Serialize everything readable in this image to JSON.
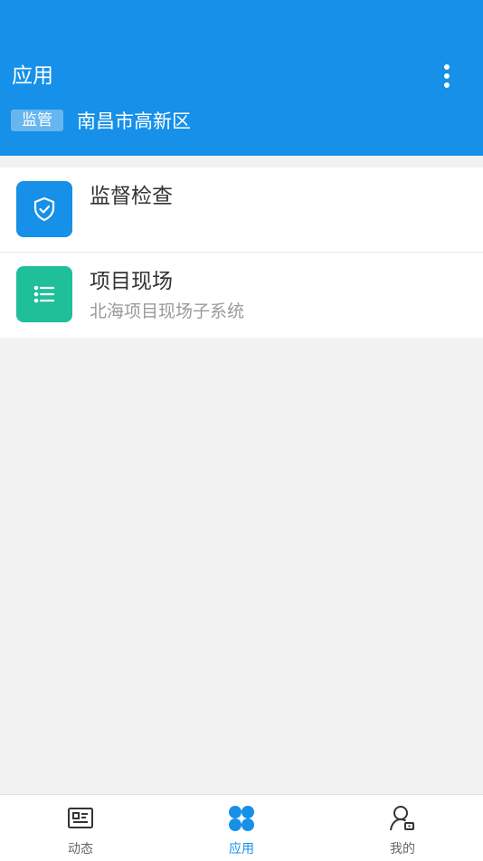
{
  "header": {
    "title": "应用",
    "more_icon": "more-vertical-icon",
    "role_badge": "监管",
    "region": "南昌市高新区",
    "background_color": "#1690e8"
  },
  "apps": [
    {
      "title": "监督检查",
      "subtitle": "",
      "icon": "shield-check-icon",
      "icon_color": "#1690e8"
    },
    {
      "title": "项目现场",
      "subtitle": "北海项目现场子系统",
      "icon": "list-icon",
      "icon_color": "#1fbf9a"
    }
  ],
  "tabbar": {
    "tabs": [
      {
        "label": "动态",
        "icon": "news-icon",
        "active": false
      },
      {
        "label": "应用",
        "icon": "apps-icon",
        "active": true
      },
      {
        "label": "我的",
        "icon": "user-icon",
        "active": false
      }
    ],
    "active_color": "#1690e8"
  }
}
